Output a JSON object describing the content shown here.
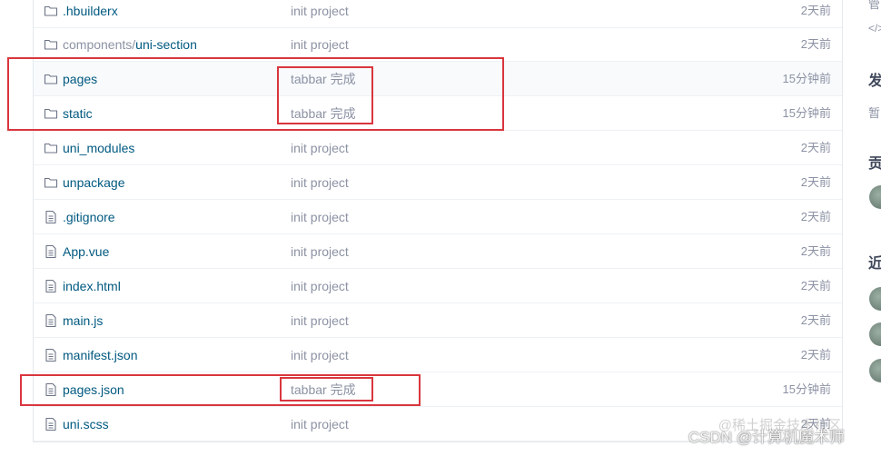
{
  "files": [
    {
      "name": "",
      "name_prefix": ".hbuilderx",
      "name_suffix": "",
      "type": "folder",
      "commit": "init project",
      "time": "2天前"
    },
    {
      "name_prefix": "components/",
      "name_suffix": "uni-section",
      "type": "folder",
      "commit": "init project",
      "time": "2天前"
    },
    {
      "name_prefix": "pages",
      "name_suffix": "",
      "type": "folder",
      "commit": "tabbar 完成",
      "time": "15分钟前"
    },
    {
      "name_prefix": "static",
      "name_suffix": "",
      "type": "folder",
      "commit": "tabbar 完成",
      "time": "15分钟前"
    },
    {
      "name_prefix": "uni_modules",
      "name_suffix": "",
      "type": "folder",
      "commit": "init project",
      "time": "2天前"
    },
    {
      "name_prefix": "unpackage",
      "name_suffix": "",
      "type": "folder",
      "commit": "init project",
      "time": "2天前"
    },
    {
      "name_prefix": ".gitignore",
      "name_suffix": "",
      "type": "file",
      "commit": "init project",
      "time": "2天前"
    },
    {
      "name_prefix": "App.vue",
      "name_suffix": "",
      "type": "file",
      "commit": "init project",
      "time": "2天前"
    },
    {
      "name_prefix": "index.html",
      "name_suffix": "",
      "type": "file",
      "commit": "init project",
      "time": "2天前"
    },
    {
      "name_prefix": "main.js",
      "name_suffix": "",
      "type": "file",
      "commit": "init project",
      "time": "2天前"
    },
    {
      "name_prefix": "manifest.json",
      "name_suffix": "",
      "type": "file",
      "commit": "init project",
      "time": "2天前"
    },
    {
      "name_prefix": "pages.json",
      "name_suffix": "",
      "type": "file",
      "commit": "tabbar 完成",
      "time": "15分钟前"
    },
    {
      "name_prefix": "uni.scss",
      "name_suffix": "",
      "type": "file",
      "commit": "init project",
      "time": "2天前"
    }
  ],
  "sidebar": {
    "top_char": "管",
    "code_glyph": "</>",
    "release_char": "发",
    "release_note": "暂",
    "contrib_char": "贡",
    "recent_char": "近"
  },
  "watermark": {
    "line1": "@稀土掘金技术社区",
    "line2": "CSDN @计算机魔术师"
  },
  "colors": {
    "link": "#005980",
    "muted": "#8c92a4",
    "highlight": "#d9363e"
  }
}
